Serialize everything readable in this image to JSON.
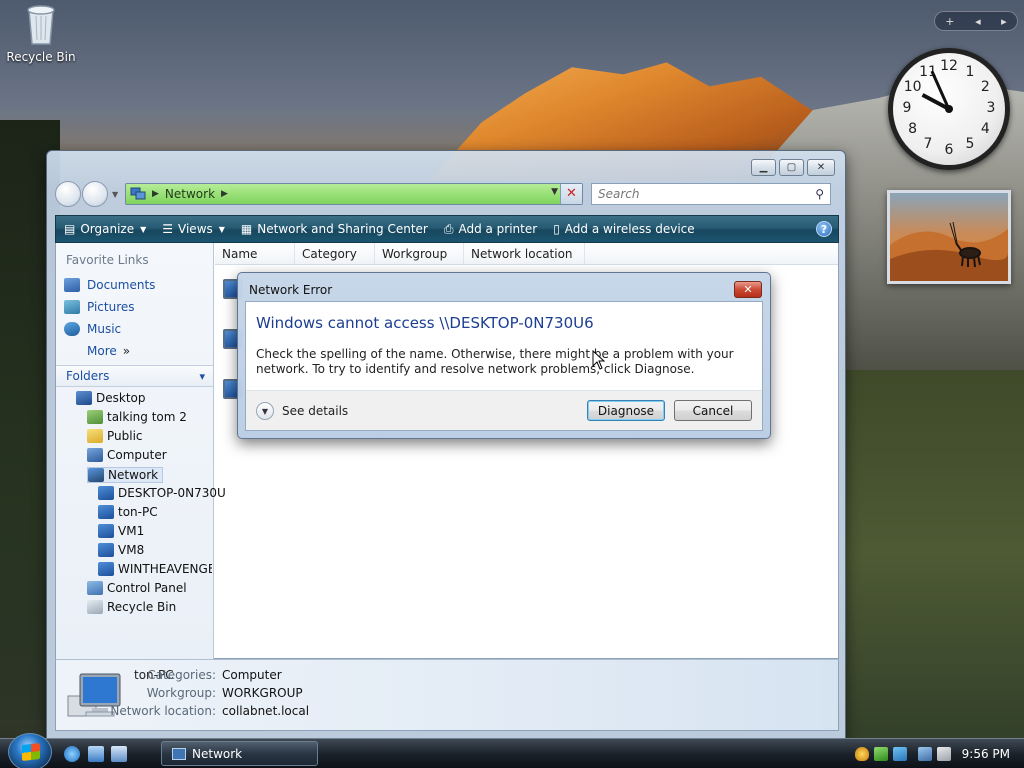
{
  "desktop": {
    "recycle_bin_label": "Recycle Bin"
  },
  "gadgets": {
    "add_symbol": "+",
    "clock_numbers": [
      "12",
      "1",
      "2",
      "3",
      "4",
      "5",
      "6",
      "7",
      "8",
      "9",
      "10",
      "11"
    ],
    "clock_hour": 9,
    "clock_minute": 56
  },
  "window": {
    "address": {
      "crumb": "Network"
    },
    "search": {
      "placeholder": "Search"
    },
    "toolbar": {
      "organize": "Organize",
      "views": "Views",
      "network_sharing_center": "Network and Sharing Center",
      "add_printer": "Add a printer",
      "add_wireless_device": "Add a wireless device",
      "help": "?"
    },
    "nav_pane": {
      "favorite_links_heading": "Favorite Links",
      "favorites": [
        "Documents",
        "Pictures",
        "Music"
      ],
      "more_label": "More",
      "folders_heading": "Folders",
      "tree": {
        "desktop": "Desktop",
        "talking_tom": "talking tom 2",
        "public": "Public",
        "computer": "Computer",
        "network": "Network",
        "net_children": [
          "DESKTOP-0N730U",
          "ton-PC",
          "VM1",
          "VM8",
          "WINTHEAVENGEF"
        ],
        "control_panel": "Control Panel",
        "recycle_bin": "Recycle Bin"
      }
    },
    "columns": [
      "Name",
      "Category",
      "Workgroup",
      "Network location"
    ],
    "details": {
      "name": "ton-PC",
      "categories_label": "Categories:",
      "categories_value": "Computer",
      "workgroup_label": "Workgroup:",
      "workgroup_value": "WORKGROUP",
      "location_label": "Network location:",
      "location_value": "collabnet.local"
    }
  },
  "dialog": {
    "title": "Network Error",
    "heading": "Windows cannot access \\\\DESKTOP-0N730U6",
    "body": "Check the spelling of the name. Otherwise, there might be a problem with your network. To try to identify and resolve network problems, click Diagnose.",
    "see_details": "See details",
    "diagnose": "Diagnose",
    "cancel": "Cancel"
  },
  "taskbar": {
    "task_label": "Network",
    "time": "9:56 PM"
  },
  "colors": {
    "address_green": "#7ed45b",
    "toolbar_teal": "#265b74",
    "link_blue": "#1b4fa3",
    "dialog_heading_blue": "#1c3e91"
  }
}
